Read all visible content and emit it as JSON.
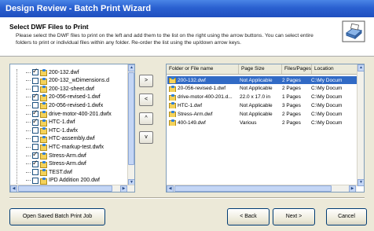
{
  "window": {
    "title": "Design Review - Batch Print Wizard"
  },
  "header": {
    "title": "Select DWF Files to Print",
    "description": "Please select the DWF files to print on the left and add them to the list on the right using the arrow buttons. You can select entire folders to print or individual files within any folder.  Re-order the list using the up/down arrow keys."
  },
  "tree": {
    "items": [
      {
        "label": "200-132.dwf",
        "checked": true
      },
      {
        "label": "200-132_wDimensions.d",
        "checked": false
      },
      {
        "label": "200-132-sheet.dwf",
        "checked": false
      },
      {
        "label": "20-056-revised-1.dwf",
        "checked": true
      },
      {
        "label": "20-056-revised-1.dwfx",
        "checked": false
      },
      {
        "label": "drive-motor-400-201.dwfx",
        "checked": true
      },
      {
        "label": "HTC-1.dwf",
        "checked": true
      },
      {
        "label": "HTC-1.dwfx",
        "checked": false
      },
      {
        "label": "HTC-assembly.dwf",
        "checked": false
      },
      {
        "label": "HTC-markup-test.dwfx",
        "checked": false
      },
      {
        "label": "Stress-Arm.dwf",
        "checked": true
      },
      {
        "label": "Stress-Arm.dwf",
        "checked": true
      },
      {
        "label": "TEST.dwf",
        "checked": false
      },
      {
        "label": "IPD Addition 200.dwf",
        "checked": false
      }
    ]
  },
  "move_buttons": {
    "add": ">",
    "remove": "<",
    "up": "^",
    "down": "v"
  },
  "list": {
    "columns": [
      "Folder or File name",
      "Page Size",
      "Files/Pages",
      "Location"
    ],
    "rows": [
      {
        "name": "200-132.dwf",
        "size": "Not Applicable",
        "pages": "2 Pages",
        "location": "C:\\My Docum",
        "selected": true
      },
      {
        "name": "20-056-revised-1.dwf",
        "size": "Not Applicable",
        "pages": "2 Pages",
        "location": "C:\\My Docum",
        "selected": false
      },
      {
        "name": "drive-motor-400-201.d...",
        "size": "22.0 x 17.0 in",
        "pages": "1 Pages",
        "location": "C:\\My Docum",
        "selected": false
      },
      {
        "name": "HTC-1.dwf",
        "size": "Not Applicable",
        "pages": "3 Pages",
        "location": "C:\\My Docum",
        "selected": false
      },
      {
        "name": "Stress-Arm.dwf",
        "size": "Not Applicable",
        "pages": "2 Pages",
        "location": "C:\\My Docum",
        "selected": false
      },
      {
        "name": "400-149.dwf",
        "size": "Various",
        "pages": "2 Pages",
        "location": "C:\\My Docum",
        "selected": false
      }
    ]
  },
  "footer": {
    "open_label": "Open Saved Batch Print Job",
    "back_label": "< Back",
    "next_label": "Next >",
    "cancel_label": "Cancel"
  },
  "colors": {
    "titlebar": "#2a60d0",
    "selection": "#316ac5"
  },
  "icons": {
    "wizard": "printer-wizard-icon",
    "file": "dwf-file-icon"
  }
}
